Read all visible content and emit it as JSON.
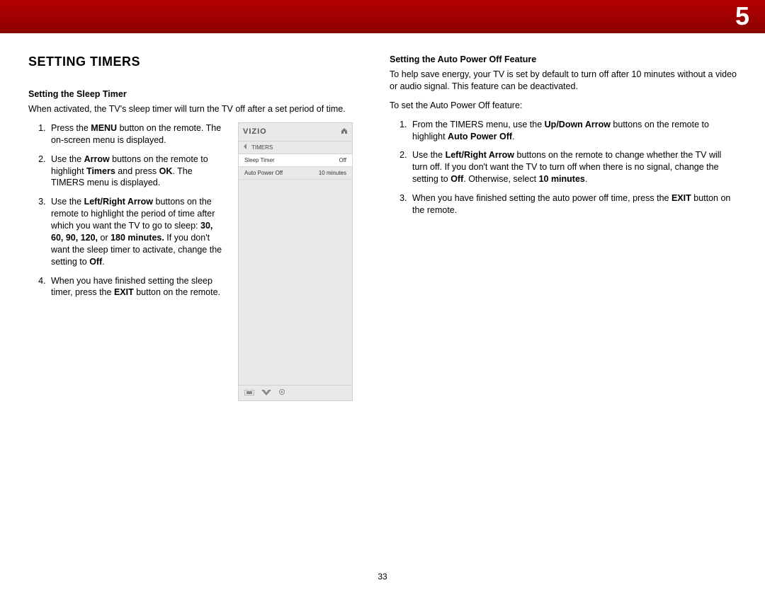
{
  "chapter_number": "5",
  "page_number": "33",
  "section_title": "SETTING TIMERS",
  "left": {
    "subhead": "Setting the Sleep Timer",
    "intro": "When activated, the TV's sleep timer will turn the TV off after a set period of time.",
    "steps": {
      "s1_a": "Press the ",
      "s1_b": "MENU",
      "s1_c": " button on the remote. The on-screen menu is displayed.",
      "s2_a": "Use the ",
      "s2_b": "Arrow",
      "s2_c": " buttons on the remote to highlight ",
      "s2_d": "Timers",
      "s2_e": " and press ",
      "s2_f": "OK",
      "s2_g": ". The TIMERS menu is displayed.",
      "s3_a": "Use the ",
      "s3_b": "Left/Right Arrow",
      "s3_c": " buttons on the remote to highlight the period of time after which you want the TV to go to sleep: ",
      "s3_d": "30, 60, 90, 120,",
      "s3_e": " or ",
      "s3_f": "180 minutes.",
      "s3_g": " If you don't want the sleep timer to activate, change the setting to ",
      "s3_h": "Off",
      "s3_i": ".",
      "s4_a": "When you have finished setting the sleep timer, press the ",
      "s4_b": "EXIT",
      "s4_c": " button on the remote."
    }
  },
  "tv_menu": {
    "logo": "VIZIO",
    "crumb": "TIMERS",
    "row1_label": "Sleep Timer",
    "row1_value": "Off",
    "row2_label": "Auto Power Off",
    "row2_value": "10 minutes"
  },
  "right": {
    "subhead": "Setting the Auto Power Off Feature",
    "intro": "To help save energy, your TV is set by default to turn off after 10 minutes without a video or audio signal. This feature can be deactivated.",
    "lead": "To set the Auto Power Off feature:",
    "steps": {
      "s1_a": "From the TIMERS menu, use the ",
      "s1_b": "Up/Down Arrow",
      "s1_c": " buttons on the remote to highlight ",
      "s1_d": "Auto Power Off",
      "s1_e": ".",
      "s2_a": "Use the ",
      "s2_b": "Left/Right Arrow",
      "s2_c": " buttons on the remote to change whether the TV will turn off. If you don't want the TV to turn off when there is no signal, change the setting to ",
      "s2_d": "Off",
      "s2_e": ". Otherwise, select ",
      "s2_f": "10 minutes",
      "s2_g": ".",
      "s3_a": "When you have finished setting the auto power off time, press the ",
      "s3_b": "EXIT",
      "s3_c": " button on the remote."
    }
  }
}
